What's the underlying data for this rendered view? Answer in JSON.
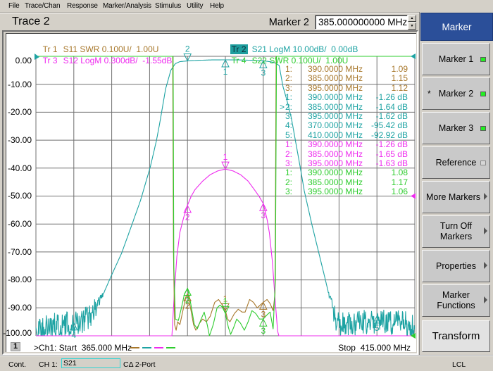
{
  "menu": [
    "File",
    "Trace/Chan",
    "Response",
    "Marker/Analysis",
    "Stimulus",
    "Utility",
    "Help"
  ],
  "header": {
    "trace_title": "Trace 2",
    "marker_label": "Marker 2",
    "marker_value": "385.000000000 MHz",
    "spin_up_icon": "▲",
    "spin_down_icon": "▼"
  },
  "legend": [
    {
      "tr": "Tr 1",
      "desc": "S11 SWR 0.100U/  1.00U",
      "trace": "S11",
      "active": false
    },
    {
      "tr": "Tr 3",
      "desc": "S12 LogM 0.300dB/  -1.55dB",
      "trace": "S12",
      "active": false
    },
    {
      "tr": "Tr 2",
      "desc": "S21 LogM 10.00dB/  0.00dB",
      "trace": "S21",
      "active": true
    },
    {
      "tr": "Tr 4",
      "desc": "S22 SWR 0.100U/  1.00U",
      "trace": "S22",
      "active": false
    }
  ],
  "marker_table": {
    "active_indicator": ">",
    "rows": [
      {
        "trace": "S11",
        "num": "1:",
        "freq": "390.0000 MHz",
        "value": "1.09",
        "active": false
      },
      {
        "trace": "S11",
        "num": "2:",
        "freq": "385.0000 MHz",
        "value": "1.15",
        "active": false
      },
      {
        "trace": "S11",
        "num": "3:",
        "freq": "395.0000 MHz",
        "value": "1.12",
        "active": false
      },
      {
        "trace": "S21",
        "num": "1:",
        "freq": "390.0000 MHz",
        "value": "-1.26 dB",
        "active": false
      },
      {
        "trace": "S21",
        "num": "2:",
        "freq": "385.0000 MHz",
        "value": "-1.64 dB",
        "active": true
      },
      {
        "trace": "S21",
        "num": "3:",
        "freq": "395.0000 MHz",
        "value": "-1.62 dB",
        "active": false
      },
      {
        "trace": "S21",
        "num": "4:",
        "freq": "370.0000 MHz",
        "value": "-95.42 dB",
        "active": false
      },
      {
        "trace": "S21",
        "num": "5:",
        "freq": "410.0000 MHz",
        "value": "-92.92 dB",
        "active": false
      },
      {
        "trace": "S12",
        "num": "1:",
        "freq": "390.0000 MHz",
        "value": "-1.26 dB",
        "active": false
      },
      {
        "trace": "S12",
        "num": "2:",
        "freq": "385.0000 MHz",
        "value": "-1.65 dB",
        "active": false
      },
      {
        "trace": "S12",
        "num": "3:",
        "freq": "395.0000 MHz",
        "value": "-1.63 dB",
        "active": false
      },
      {
        "trace": "S22",
        "num": "1:",
        "freq": "390.0000 MHz",
        "value": "1.08",
        "active": false
      },
      {
        "trace": "S22",
        "num": "2:",
        "freq": "385.0000 MHz",
        "value": "1.17",
        "active": false
      },
      {
        "trace": "S22",
        "num": "3:",
        "freq": "395.0000 MHz",
        "value": "1.06",
        "active": false
      }
    ]
  },
  "footer": {
    "window_number": "1",
    "start": ">Ch1: Start  365.000 MHz",
    "stop": "Stop  415.000 MHz"
  },
  "softkeys": {
    "header": "Marker",
    "items": [
      {
        "label_lines": [
          "Marker 1"
        ],
        "indicator": "led-on",
        "prefix": ""
      },
      {
        "label_lines": [
          "Marker 2"
        ],
        "indicator": "led-on",
        "prefix": "*"
      },
      {
        "label_lines": [
          "Marker 3"
        ],
        "indicator": "led-on",
        "prefix": ""
      },
      {
        "label_lines": [
          "Reference"
        ],
        "indicator": "led-off",
        "prefix": ""
      },
      {
        "label_lines": [
          "More Markers"
        ],
        "indicator": "submenu-arrow",
        "prefix": ""
      },
      {
        "label_lines": [
          "Turn Off",
          "Markers"
        ],
        "indicator": "submenu-arrow",
        "prefix": ""
      },
      {
        "label_lines": [
          "Properties"
        ],
        "indicator": "submenu-arrow",
        "prefix": ""
      },
      {
        "label_lines": [
          "Marker",
          "Functions"
        ],
        "indicator": "submenu-arrow",
        "prefix": ""
      },
      {
        "label_lines": [
          "Transform"
        ],
        "indicator": "",
        "prefix": ""
      }
    ]
  },
  "status_bar": {
    "mode": "Cont.",
    "channel": "CH 1:",
    "measurement": "S21",
    "calibration": "CΔ 2-Port",
    "remote": "LCL"
  },
  "chart_data": {
    "type": "line",
    "title": "Trace 2",
    "xlabel": "",
    "ylabel": "",
    "x_range_mhz": [
      365,
      415
    ],
    "x_divisions": 10,
    "y_divisions": 10,
    "grid": true,
    "y_ticks_trace": "S21",
    "y_ticks": [
      "0.00",
      "-10.00",
      "-20.00",
      "-30.00",
      "-40.00",
      "-50.00",
      "-60.00",
      "-70.00",
      "-80.00",
      "-90.00",
      "-100.00"
    ],
    "series": [
      {
        "name": "Tr 2",
        "param": "S21",
        "format": "LogM",
        "unit": "dB",
        "scale_per_div": 10.0,
        "ref_value": 0.0,
        "ylim": [
          -100,
          0
        ],
        "color": "#1ea3a3",
        "active": true,
        "noise": {
          "below_db": -84,
          "peak_to_peak_db": 9
        },
        "points": [
          [
            365,
            -97
          ],
          [
            370,
            -95.42
          ],
          [
            371.5,
            -94
          ],
          [
            372.8,
            -90.7
          ],
          [
            373.9,
            -85
          ],
          [
            374.9,
            -78.8
          ],
          [
            376.3,
            -70.5
          ],
          [
            377.5,
            -61.5
          ],
          [
            378.8,
            -51.6
          ],
          [
            380.1,
            -39.5
          ],
          [
            380.9,
            -30.2
          ],
          [
            381.4,
            -23
          ],
          [
            382.1,
            -11.8
          ],
          [
            382.8,
            -5
          ],
          [
            383.4,
            -2.6
          ],
          [
            384,
            -1.9
          ],
          [
            385,
            -1.64
          ],
          [
            386.5,
            -1.42
          ],
          [
            388,
            -1.3
          ],
          [
            390,
            -1.26
          ],
          [
            392,
            -1.3
          ],
          [
            393.5,
            -1.42
          ],
          [
            395,
            -1.62
          ],
          [
            396,
            -1.95
          ],
          [
            396.6,
            -2.4
          ],
          [
            397.1,
            -3.3
          ],
          [
            397.6,
            -10.8
          ],
          [
            398.1,
            -15.5
          ],
          [
            398.7,
            -22
          ],
          [
            399.3,
            -31
          ],
          [
            399.9,
            -40
          ],
          [
            400.4,
            -48
          ],
          [
            401.4,
            -60
          ],
          [
            402.3,
            -70
          ],
          [
            403.2,
            -80
          ],
          [
            403.9,
            -88
          ],
          [
            404.3,
            -92
          ],
          [
            404.8,
            -96
          ],
          [
            410,
            -95
          ],
          [
            415,
            -96
          ]
        ],
        "markers": [
          {
            "n": "1",
            "freq_mhz": 390,
            "value": -1.26,
            "pointer": "up"
          },
          {
            "n": "2",
            "freq_mhz": 385,
            "value": -1.64,
            "pointer": "down"
          },
          {
            "n": "3",
            "freq_mhz": 395,
            "value": -1.62,
            "pointer": "up"
          },
          {
            "n": "4",
            "freq_mhz": 370,
            "value": -95.42,
            "pointer": "up"
          },
          {
            "n": "5",
            "freq_mhz": 410,
            "value": -92.92,
            "pointer": "up"
          }
        ]
      },
      {
        "name": "Tr 3",
        "param": "S12",
        "format": "LogM",
        "unit": "dB",
        "scale_per_div": 0.3,
        "ref_value": -1.55,
        "ylim": [
          -3.05,
          -0.05
        ],
        "color": "#ee2cee",
        "active": false,
        "points": [
          [
            365,
            -3.3
          ],
          [
            382.95,
            -3.3
          ],
          [
            383.05,
            -2.9
          ],
          [
            383.3,
            -2.55
          ],
          [
            383.6,
            -2.2
          ],
          [
            384,
            -1.94
          ],
          [
            384.5,
            -1.78
          ],
          [
            385,
            -1.65
          ],
          [
            385.5,
            -1.55
          ],
          [
            386,
            -1.48
          ],
          [
            387,
            -1.39
          ],
          [
            388,
            -1.32
          ],
          [
            389,
            -1.28
          ],
          [
            390,
            -1.26
          ],
          [
            391,
            -1.28
          ],
          [
            392,
            -1.32
          ],
          [
            393,
            -1.39
          ],
          [
            394,
            -1.5
          ],
          [
            394.5,
            -1.56
          ],
          [
            395,
            -1.63
          ],
          [
            395.5,
            -1.8
          ],
          [
            395.8,
            -1.94
          ],
          [
            396.2,
            -2.25
          ],
          [
            396.6,
            -2.7
          ],
          [
            396.9,
            -3.0
          ],
          [
            397.05,
            -3.3
          ],
          [
            415,
            -3.3
          ]
        ],
        "markers": [
          {
            "n": "1",
            "freq_mhz": 390,
            "value": -1.26,
            "pointer": "down"
          },
          {
            "n": "2",
            "freq_mhz": 385,
            "value": -1.65,
            "pointer": "up"
          },
          {
            "n": "3",
            "freq_mhz": 395,
            "value": -1.63,
            "pointer": "up"
          }
        ]
      },
      {
        "name": "Tr 1",
        "param": "S11",
        "format": "SWR",
        "unit": "U",
        "scale_per_div": 0.1,
        "ref_value": 1.0,
        "ylim": [
          1.0,
          2.0
        ],
        "color": "#a8782c",
        "active": false,
        "points": [
          [
            365,
            40
          ],
          [
            383.05,
            40
          ],
          [
            383.15,
            1.3
          ],
          [
            383.3,
            1.04
          ],
          [
            383.5,
            1.02
          ],
          [
            383.7,
            1.05
          ],
          [
            384,
            1.04
          ],
          [
            384.4,
            1.09
          ],
          [
            384.8,
            1.14
          ],
          [
            385,
            1.15
          ],
          [
            385.4,
            1.1
          ],
          [
            385.8,
            1.04
          ],
          [
            386.1,
            1.02
          ],
          [
            386.6,
            1.045
          ],
          [
            387,
            1.06
          ],
          [
            387.5,
            1.05
          ],
          [
            388,
            1.07
          ],
          [
            388.6,
            1.12
          ],
          [
            389.1,
            1.13
          ],
          [
            389.6,
            1.11
          ],
          [
            390,
            1.09
          ],
          [
            390.3,
            1.06
          ],
          [
            390.6,
            1.05
          ],
          [
            391.2,
            1.08
          ],
          [
            391.7,
            1.095
          ],
          [
            392.2,
            1.085
          ],
          [
            392.6,
            1.085
          ],
          [
            393.2,
            1.13
          ],
          [
            393.7,
            1.12
          ],
          [
            394.2,
            1.1
          ],
          [
            394.6,
            1.11
          ],
          [
            395,
            1.12
          ],
          [
            395.5,
            1.13
          ],
          [
            395.9,
            1.115
          ],
          [
            396.3,
            1.09
          ],
          [
            396.55,
            1.15
          ],
          [
            396.7,
            40
          ],
          [
            415,
            40
          ]
        ],
        "markers": [
          {
            "n": "1",
            "freq_mhz": 390,
            "value": 1.09,
            "pointer": "down"
          },
          {
            "n": "2",
            "freq_mhz": 385,
            "value": 1.15,
            "pointer": "up"
          },
          {
            "n": "3",
            "freq_mhz": 395,
            "value": 1.12,
            "pointer": "up"
          }
        ]
      },
      {
        "name": "Tr 4",
        "param": "S22",
        "format": "SWR",
        "unit": "U",
        "scale_per_div": 0.1,
        "ref_value": 1.0,
        "ylim": [
          1.0,
          2.0
        ],
        "color": "#2ecc2e",
        "active": false,
        "points": [
          [
            365,
            40
          ],
          [
            383.1,
            40
          ],
          [
            383.2,
            1.25
          ],
          [
            383.4,
            1.06
          ],
          [
            383.8,
            1.055
          ],
          [
            384.2,
            1.1
          ],
          [
            384.6,
            1.15
          ],
          [
            385,
            1.17
          ],
          [
            385.4,
            1.12
          ],
          [
            385.9,
            1.04
          ],
          [
            386.3,
            1.025
          ],
          [
            386.8,
            1.06
          ],
          [
            387.2,
            1.085
          ],
          [
            387.6,
            1.04
          ],
          [
            387.9,
            1.0
          ],
          [
            388.4,
            1.04
          ],
          [
            388.9,
            1.1
          ],
          [
            389.3,
            1.11
          ],
          [
            389.7,
            1.1
          ],
          [
            390,
            1.08
          ],
          [
            390.4,
            1.03
          ],
          [
            390.7,
            1.005
          ],
          [
            391.1,
            1.03
          ],
          [
            391.5,
            1.06
          ],
          [
            392,
            1.045
          ],
          [
            392.5,
            1.02
          ],
          [
            393,
            1.05
          ],
          [
            393.5,
            1.09
          ],
          [
            394,
            1.08
          ],
          [
            394.5,
            1.06
          ],
          [
            395,
            1.06
          ],
          [
            395.5,
            1.075
          ],
          [
            395.9,
            1.085
          ],
          [
            396.3,
            1.025
          ],
          [
            396.6,
            1.2
          ],
          [
            396.75,
            40
          ],
          [
            415,
            40
          ]
        ],
        "markers": [
          {
            "n": "1",
            "freq_mhz": 390,
            "value": 1.08,
            "pointer": "down"
          },
          {
            "n": "2",
            "freq_mhz": 385,
            "value": 1.17,
            "pointer": "up"
          },
          {
            "n": "3",
            "freq_mhz": 395,
            "value": 1.06,
            "pointer": "up"
          }
        ]
      }
    ]
  }
}
